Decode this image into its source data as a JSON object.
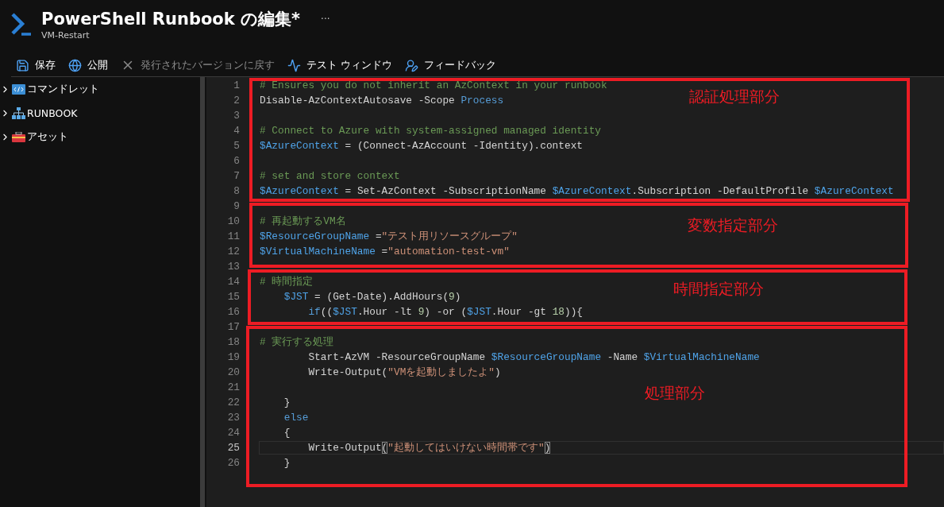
{
  "header": {
    "title": "PowerShell Runbook の編集*",
    "subtitle": "VM-Restart",
    "more": "···"
  },
  "toolbar": [
    {
      "kind": "save",
      "label": "保存",
      "disabled": false
    },
    {
      "kind": "publish",
      "label": "公開",
      "disabled": false
    },
    {
      "kind": "revert",
      "label": "発行されたバージョンに戻す",
      "disabled": true
    },
    {
      "kind": "test",
      "label": "テスト ウィンドウ",
      "disabled": false
    },
    {
      "kind": "feedback",
      "label": "フィードバック",
      "disabled": false
    }
  ],
  "sidebar": {
    "items": [
      {
        "kind": "cmdlet",
        "label": "コマンドレット",
        "expanded": false
      },
      {
        "kind": "runbook",
        "label": "RUNBOOK",
        "expanded": false
      },
      {
        "kind": "asset",
        "label": "アセット",
        "expanded": false
      }
    ]
  },
  "editor": {
    "lines": [
      {
        "number": "1",
        "current": false,
        "tokens": [
          {
            "kind": "comment",
            "text": "# Ensures you do not inherit an AzContext in your runbook"
          }
        ]
      },
      {
        "number": "2",
        "current": false,
        "tokens": [
          {
            "kind": "plain",
            "text": "Disable-AzContextAutosave -Scope "
          },
          {
            "kind": "keyword",
            "text": "Process"
          }
        ]
      },
      {
        "number": "3",
        "current": false
      },
      {
        "number": "4",
        "current": false,
        "tokens": [
          {
            "kind": "comment",
            "text": "# Connect to Azure with system-assigned managed identity"
          }
        ]
      },
      {
        "number": "5",
        "current": false,
        "tokens": [
          {
            "kind": "variable",
            "text": "$AzureContext"
          },
          {
            "kind": "plain",
            "text": " = (Connect-AzAccount -Identity).context"
          }
        ]
      },
      {
        "number": "6",
        "current": false
      },
      {
        "number": "7",
        "current": false,
        "tokens": [
          {
            "kind": "comment",
            "text": "# set and store context"
          }
        ]
      },
      {
        "number": "8",
        "current": false,
        "tokens": [
          {
            "kind": "variable",
            "text": "$AzureContext"
          },
          {
            "kind": "plain",
            "text": " = Set-AzContext -SubscriptionName "
          },
          {
            "kind": "variable",
            "text": "$AzureContext"
          },
          {
            "kind": "plain",
            "text": ".Subscription -DefaultProfile "
          },
          {
            "kind": "variable",
            "text": "$AzureContext"
          }
        ]
      },
      {
        "number": "9",
        "current": false
      },
      {
        "number": "10",
        "current": false,
        "tokens": [
          {
            "kind": "comment",
            "text": "# 再起動するVM名"
          }
        ]
      },
      {
        "number": "11",
        "current": false,
        "tokens": [
          {
            "kind": "variable",
            "text": "$ResourceGroupName"
          },
          {
            "kind": "plain",
            "text": " ="
          },
          {
            "kind": "string",
            "text": "\"テスト用リソースグループ\""
          }
        ]
      },
      {
        "number": "12",
        "current": false,
        "tokens": [
          {
            "kind": "variable",
            "text": "$VirtualMachineName"
          },
          {
            "kind": "plain",
            "text": " ="
          },
          {
            "kind": "string",
            "text": "\"automation-test-vm\""
          }
        ]
      },
      {
        "number": "13",
        "current": false
      },
      {
        "number": "14",
        "current": false,
        "tokens": [
          {
            "kind": "comment",
            "text": "# 時間指定"
          }
        ]
      },
      {
        "number": "15",
        "current": false,
        "tokens": [
          {
            "kind": "variable",
            "text": "    $JST"
          },
          {
            "kind": "plain",
            "text": " = (Get-Date).AddHours("
          },
          {
            "kind": "number",
            "text": "9"
          },
          {
            "kind": "plain",
            "text": ")"
          }
        ]
      },
      {
        "number": "16",
        "current": false,
        "tokens": [
          {
            "kind": "keyword",
            "text": "        if"
          },
          {
            "kind": "plain",
            "text": "(("
          },
          {
            "kind": "variable",
            "text": "$JST"
          },
          {
            "kind": "plain",
            "text": ".Hour -lt "
          },
          {
            "kind": "number",
            "text": "9"
          },
          {
            "kind": "plain",
            "text": ") -or ("
          },
          {
            "kind": "variable",
            "text": "$JST"
          },
          {
            "kind": "plain",
            "text": ".Hour -gt "
          },
          {
            "kind": "number",
            "text": "18"
          },
          {
            "kind": "plain",
            "text": ")){"
          }
        ]
      },
      {
        "number": "17",
        "current": false
      },
      {
        "number": "18",
        "current": false,
        "tokens": [
          {
            "kind": "comment",
            "text": "# 実行する処理"
          }
        ]
      },
      {
        "number": "19",
        "current": false,
        "tokens": [
          {
            "kind": "plain",
            "text": "        Start-AzVM -ResourceGroupName "
          },
          {
            "kind": "variable",
            "text": "$ResourceGroupName"
          },
          {
            "kind": "plain",
            "text": " -Name "
          },
          {
            "kind": "variable",
            "text": "$VirtualMachineName"
          }
        ]
      },
      {
        "number": "20",
        "current": false,
        "tokens": [
          {
            "kind": "plain",
            "text": "        Write-Output("
          },
          {
            "kind": "string",
            "text": "\"VMを起動しましたよ\""
          },
          {
            "kind": "plain",
            "text": ")"
          }
        ]
      },
      {
        "number": "21",
        "current": false
      },
      {
        "number": "22",
        "current": false,
        "tokens": [
          {
            "kind": "plain",
            "text": "    }"
          }
        ]
      },
      {
        "number": "23",
        "current": false,
        "tokens": [
          {
            "kind": "keyword",
            "text": "    else"
          }
        ]
      },
      {
        "number": "24",
        "current": false,
        "tokens": [
          {
            "kind": "plain",
            "text": "    {"
          }
        ]
      },
      {
        "number": "25",
        "current": true,
        "tokens": [
          {
            "kind": "plain",
            "text": "        Write-Output"
          },
          {
            "kind": "bracket",
            "text": "("
          },
          {
            "kind": "string",
            "text": "\"起動してはいけない時間帯です\""
          },
          {
            "kind": "bracket",
            "text": ")"
          }
        ]
      },
      {
        "number": "26",
        "current": false,
        "tokens": [
          {
            "kind": "plain",
            "text": "    }"
          }
        ]
      }
    ]
  },
  "annotations": [
    {
      "label": "認証処理部分"
    },
    {
      "label": "変数指定部分"
    },
    {
      "label": "時間指定部分"
    },
    {
      "label": "処理部分"
    }
  ]
}
